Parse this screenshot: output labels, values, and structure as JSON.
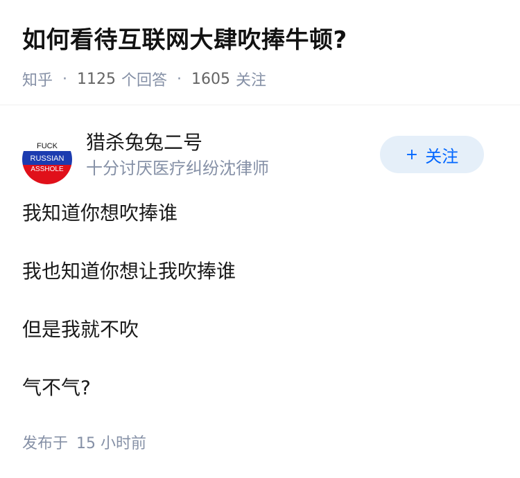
{
  "question": {
    "title": "如何看待互联网大肆吹捧牛顿?",
    "source": "知乎",
    "answer_count": "1125",
    "answer_label": "个回答",
    "follower_count": "1605",
    "follower_label": "关注"
  },
  "author": {
    "name": "猎杀兔兔二号",
    "bio": "十分讨厌医疗纠纷沈律师",
    "avatar_text_top": "FUCK",
    "avatar_text_mid": "RUSSIAN",
    "avatar_text_bottom": "ASSHOLE",
    "follow_plus": "+",
    "follow_label": "关注"
  },
  "answer": {
    "paragraphs": [
      "我知道你想吹捧谁",
      "我也知道你想让我吹捧谁",
      "但是我就不吹",
      "气不气?"
    ],
    "published_label": "发布于",
    "published_time": "15 小时前"
  },
  "colors": {
    "accent": "#0066ff",
    "follow_bg": "#e5eff9",
    "meta_gray": "#8590a6"
  }
}
